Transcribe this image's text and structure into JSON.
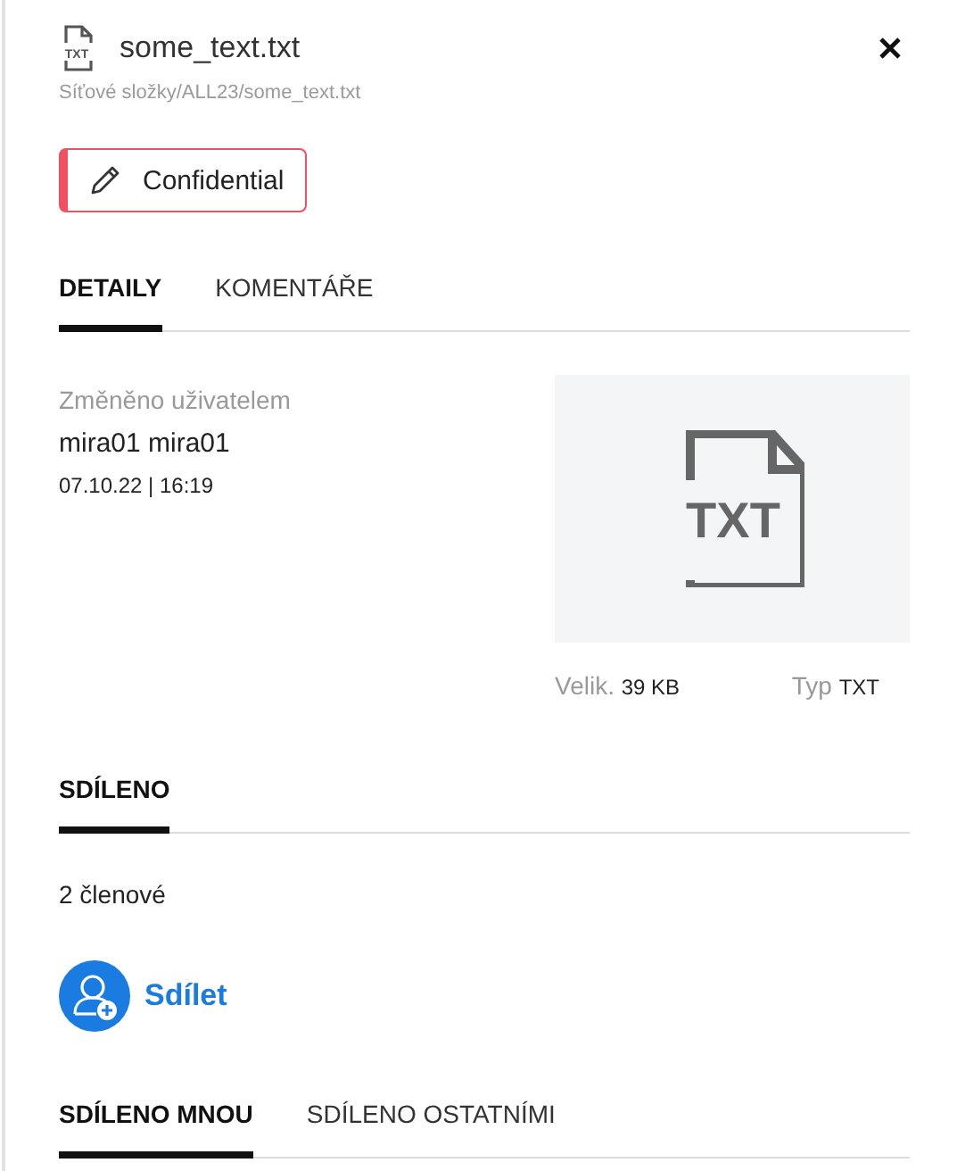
{
  "header": {
    "icon_text": "TXT",
    "title": "some_text.txt",
    "path": "Síťové složky/ALL23/some_text.txt"
  },
  "label": {
    "text": "Confidential",
    "color": "#f0505f"
  },
  "tabs": [
    {
      "label": "DETAILY",
      "selected": true
    },
    {
      "label": "KOMENTÁŘE",
      "selected": false
    }
  ],
  "details": {
    "modified_label": "Změněno uživatelem",
    "user": "mira01 mira01",
    "date": "07.10.22 | 16:19",
    "preview_icon_text": "TXT",
    "size_label": "Velik.",
    "size": "39 KB",
    "type_label": "Typ",
    "type": "TXT"
  },
  "sharing": {
    "title": "SDÍLENO",
    "members": "2 členové",
    "share_button": "Sdílet"
  },
  "share_tabs": [
    {
      "label": "SDÍLENO MNOU",
      "selected": true
    },
    {
      "label": "SDÍLENO OSTATNÍMI",
      "selected": false
    }
  ]
}
